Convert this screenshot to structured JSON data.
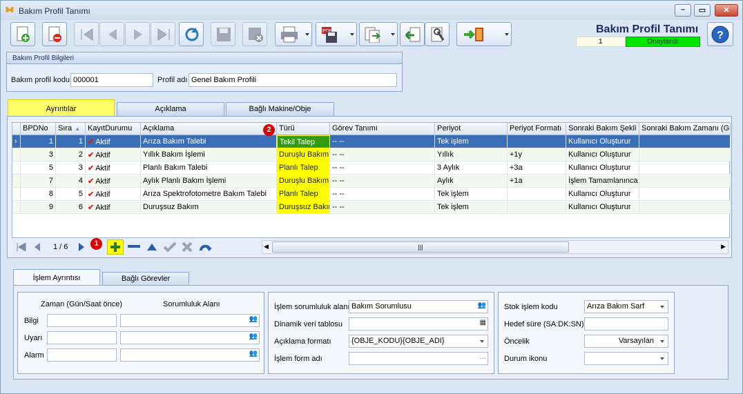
{
  "window": {
    "title": "Bakım Profil Tanımı"
  },
  "header": {
    "title": "Bakım Profil Tanımı",
    "record_no": "1",
    "status": "Onaylandı",
    "status_color": "#00e600"
  },
  "toolbar": {
    "buttons": [
      "new-icon",
      "delete-icon",
      "first-icon",
      "prev-icon",
      "next-icon",
      "last-icon",
      "refresh-icon",
      "save-icon",
      "cancel-save-icon",
      "print-icon",
      "pdf-icon",
      "export-icon",
      "import-icon",
      "tools-icon",
      "exit-icon",
      "help-icon"
    ]
  },
  "info": {
    "group_title": "Bakım Profil Bilgileri",
    "code_label": "Bakım profil kodu",
    "code_value": "000001",
    "name_label": "Profil adı",
    "name_value": "Genel Bakım Profili"
  },
  "tabs": [
    {
      "label": "Ayrıntılar"
    },
    {
      "label": "Açıklama"
    },
    {
      "label": "Bağlı Makine/Obje"
    }
  ],
  "grid": {
    "columns": [
      "BPDNo",
      "Sıra",
      "KayıtDurumu",
      "Açıklama",
      "Türü",
      "Görev Tanımı",
      "Periyot",
      "Periyot Formatı",
      "Sonraki Bakım Şekli",
      "Sonraki Bakım Zamanı (Gün"
    ],
    "rows": [
      {
        "bpdno": "1",
        "sira": "1",
        "durum": "Aktif",
        "aciklama": "Arıza Bakım Talebi",
        "turu": "Tekil Talep",
        "gorev": "-- --",
        "periyot": "Tek işlem",
        "format": "",
        "sekil": "Kullanıcı Oluşturur"
      },
      {
        "bpdno": "3",
        "sira": "2",
        "durum": "Aktif",
        "aciklama": "Yıllık Bakım İşlemi",
        "turu": "Duruşlu Bakım",
        "gorev": "-- --",
        "periyot": "Yıllık",
        "format": "+1y",
        "sekil": "Kullanıcı Oluşturur"
      },
      {
        "bpdno": "5",
        "sira": "3",
        "durum": "Aktif",
        "aciklama": "Planlı Bakım Talebi",
        "turu": "Planlı Talep",
        "gorev": "-- --",
        "periyot": "3 Aylık",
        "format": "+3a",
        "sekil": "Kullanıcı Oluşturur"
      },
      {
        "bpdno": "7",
        "sira": "4",
        "durum": "Aktif",
        "aciklama": "Aylık Planlı Bakım İşlemi",
        "turu": "Duruşlu Bakım",
        "gorev": "-- --",
        "periyot": "Aylık",
        "format": "+1a",
        "sekil": "İşlem Tamamlanınca"
      },
      {
        "bpdno": "8",
        "sira": "5",
        "durum": "Aktif",
        "aciklama": "Arıza Spektrofotometre Bakım Talebi",
        "turu": "Planlı Talep",
        "gorev": "-- --",
        "periyot": "Tek işlem",
        "format": "",
        "sekil": "Kullanıcı Oluşturur"
      },
      {
        "bpdno": "9",
        "sira": "6",
        "durum": "Aktif",
        "aciklama": "Duruşsuz Bakım",
        "turu": "Duruşsuz Bakım",
        "gorev": "-- --",
        "periyot": "Tek işlem",
        "format": "",
        "sekil": "Kullanıcı Oluşturur"
      }
    ],
    "highlight_color": "#fdfd00"
  },
  "nav": {
    "position": "1 / 6",
    "badge1": "1",
    "badge2": "2"
  },
  "subtabs": [
    {
      "label": "İşlem Ayrıntısı"
    },
    {
      "label": "Bağlı Görevler"
    }
  ],
  "left_panel": {
    "time_header": "Zaman (Gün/Saat önce)",
    "resp_header": "Sorumluluk Alanı",
    "rows": [
      "Bilgi",
      "Uyarı",
      "Alarm"
    ]
  },
  "mid_panel": {
    "resp_label": "İşlem sorumluluk alanı",
    "resp_value": "Bakım Sorumlusu",
    "dyn_label": "Dinamik veri tablosu",
    "fmt_label": "Açıklama formatı",
    "fmt_value": "{OBJE_KODU}{OBJE_ADI}",
    "form_label": "İşlem form adı"
  },
  "right_panel": {
    "stock_label": "Stok işlem kodu",
    "stock_value": "Arıza Bakım Sarf",
    "target_label": "Hedef süre (SA:DK:SN)",
    "priority_label": "Öncelik",
    "priority_value": "Varsayılan",
    "icon_label": "Durum ikonu"
  }
}
